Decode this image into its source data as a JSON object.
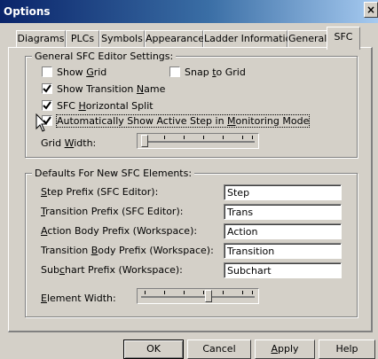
{
  "window": {
    "title": "Options",
    "close_glyph": "×"
  },
  "tabs": [
    {
      "label": "Diagrams",
      "active": false
    },
    {
      "label": "PLCs",
      "active": false
    },
    {
      "label": "Symbols",
      "active": false
    },
    {
      "label": "Appearance",
      "active": false
    },
    {
      "label": "Ladder Information",
      "active": false
    },
    {
      "label": "General",
      "active": false
    },
    {
      "label": "SFC",
      "active": true
    }
  ],
  "editor_group": {
    "title": "General SFC Editor Settings:",
    "checkboxes": [
      {
        "pre": "Show ",
        "key": "G",
        "post": "rid",
        "checked": false
      },
      {
        "pre": "Snap ",
        "key": "t",
        "post": "o Grid",
        "checked": false
      },
      {
        "pre": "Show Transition ",
        "key": "N",
        "post": "ame",
        "checked": true
      },
      {
        "pre": "SFC ",
        "key": "H",
        "post": "orizontal Split",
        "checked": true
      },
      {
        "pre": "Automatically Show Active Step in ",
        "key": "M",
        "post": "onitoring Mode",
        "checked": true,
        "focused": true
      }
    ],
    "grid_width": {
      "pre": "Grid ",
      "key": "W",
      "post": "idth:",
      "value_fraction": 0.0
    }
  },
  "defaults_group": {
    "title": "Defaults For New SFC Elements:",
    "fields": [
      {
        "pre": "",
        "key": "S",
        "post": "tep Prefix (SFC Editor):",
        "value": "Step"
      },
      {
        "pre": "",
        "key": "T",
        "post": "ransition Prefix (SFC Editor):",
        "value": "Trans"
      },
      {
        "pre": "",
        "key": "A",
        "post": "ction Body Prefix (Workspace):",
        "value": "Action"
      },
      {
        "pre": "Transition ",
        "key": "B",
        "post": "ody Prefix (Workspace):",
        "value": "Transition"
      },
      {
        "pre": "Sub",
        "key": "c",
        "post": "hart Prefix (Workspace):",
        "value": "Subchart"
      }
    ],
    "element_width": {
      "pre": "",
      "key": "E",
      "post": "lement Width:",
      "value_fraction": 0.6
    }
  },
  "buttons": [
    {
      "pre": "",
      "key": "",
      "post": "OK",
      "default": true
    },
    {
      "pre": "",
      "key": "",
      "post": "Cancel",
      "default": false
    },
    {
      "pre": "",
      "key": "A",
      "post": "pply",
      "default": false
    },
    {
      "pre": "",
      "key": "",
      "post": "Help",
      "default": false
    }
  ]
}
